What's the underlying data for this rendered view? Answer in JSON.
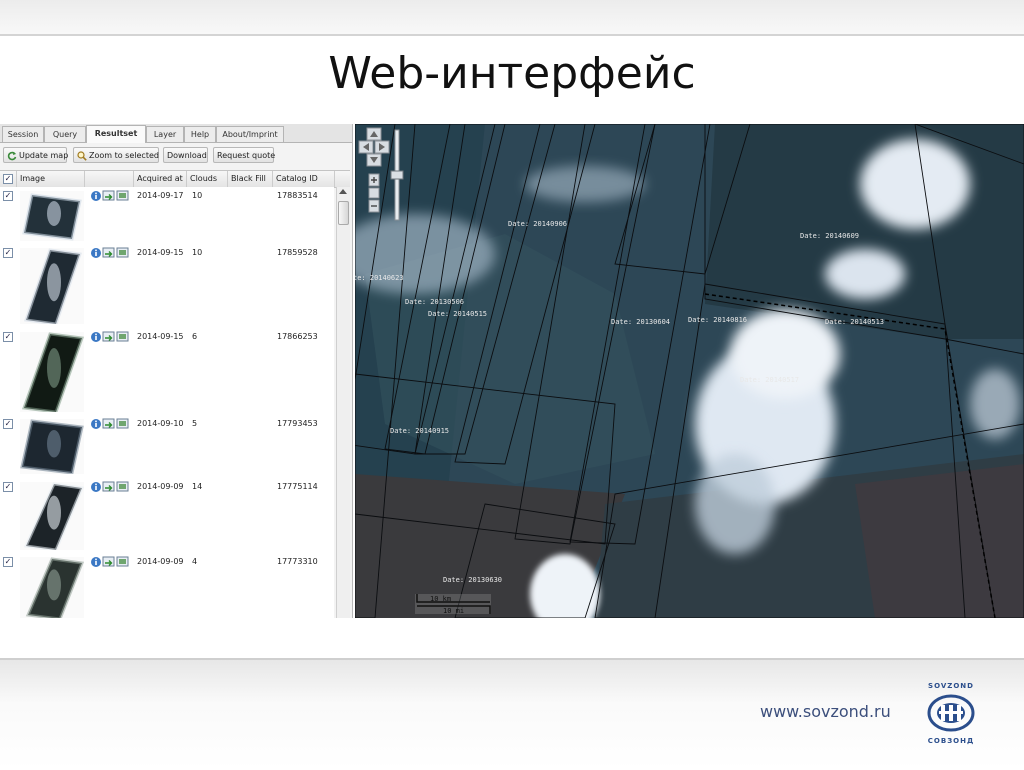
{
  "slide": {
    "title": "Web-интерфейс",
    "url": "www.sovzond.ru",
    "logo_top": "SOVZOND",
    "logo_bottom": "СОВЗОНД"
  },
  "tabs": [
    {
      "label": "Session",
      "active": false
    },
    {
      "label": "Query",
      "active": false
    },
    {
      "label": "Resultset",
      "active": true
    },
    {
      "label": "Layer",
      "active": false
    },
    {
      "label": "Help",
      "active": false
    },
    {
      "label": "About/Imprint",
      "active": false
    }
  ],
  "toolbar": {
    "update_map": "Update map",
    "zoom_selected": "Zoom to selected",
    "download": "Download",
    "request_quote": "Request quote"
  },
  "grid": {
    "columns": [
      "Image",
      "Acquired at",
      "Clouds",
      "Black Fill",
      "Catalog ID"
    ],
    "rows": [
      {
        "date": "2014-09-17",
        "clouds": "10",
        "black_fill": "",
        "catalog_id": "17883514",
        "checked": "✓"
      },
      {
        "date": "2014-09-15",
        "clouds": "10",
        "black_fill": "",
        "catalog_id": "17859528",
        "checked": "✓"
      },
      {
        "date": "2014-09-15",
        "clouds": "6",
        "black_fill": "",
        "catalog_id": "17866253",
        "checked": "✓"
      },
      {
        "date": "2014-09-10",
        "clouds": "5",
        "black_fill": "",
        "catalog_id": "17793453",
        "checked": "✓"
      },
      {
        "date": "2014-09-09",
        "clouds": "14",
        "black_fill": "",
        "catalog_id": "17775114",
        "checked": "✓"
      },
      {
        "date": "2014-09-09",
        "clouds": "4",
        "black_fill": "",
        "catalog_id": "17773310",
        "checked": "✓"
      }
    ],
    "header_check": "✓"
  },
  "map": {
    "footprint_labels": [
      {
        "text": "Date: 20140906"
      },
      {
        "text": "Date: 20140609"
      },
      {
        "text": "te: 20140623"
      },
      {
        "text": "Date: 20130506"
      },
      {
        "text": "Date: 20140515"
      },
      {
        "text": "Date: 20130604"
      },
      {
        "text": "Date: 20140816"
      },
      {
        "text": "Date: 20140513"
      },
      {
        "text": "Date: 20140517"
      },
      {
        "text": "Date: 20140915"
      },
      {
        "text": "Date: 20130630"
      }
    ],
    "scale_km": "10 km",
    "scale_mi": "10 mi"
  },
  "icons": {
    "tab_toolbar": [
      "refresh-icon",
      "zoom-icon"
    ],
    "row": [
      "info-icon",
      "add-to-map-icon",
      "preview-icon"
    ],
    "map_nav": [
      "pan-up-icon",
      "pan-left-icon",
      "pan-right-icon",
      "pan-down-icon",
      "zoom-in-icon",
      "zoom-out-icon"
    ]
  },
  "colors": {
    "title_text": "#111111",
    "url_text": "#3c4f7c",
    "logo_blue": "#2b4e8c",
    "map_base": "#2d4756",
    "cloud": "#e9eef5"
  }
}
